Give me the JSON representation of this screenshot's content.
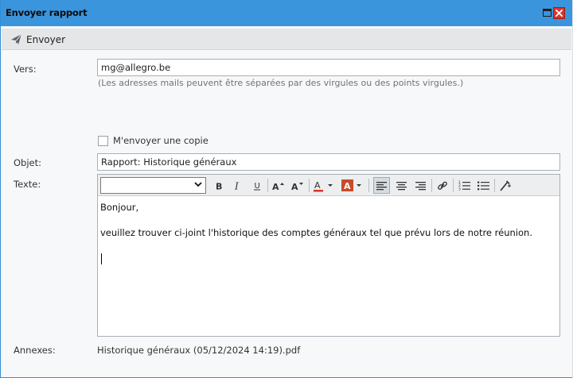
{
  "window": {
    "title": "Envoyer rapport"
  },
  "toolbar": {
    "send_label": "Envoyer"
  },
  "form": {
    "to_label": "Vers:",
    "to_value": "mg@allegro.be",
    "to_hint": "(Les adresses mails peuvent être séparées par des virgules ou des points virgules.)",
    "copy_label": "M'envoyer une copie",
    "copy_checked": false,
    "subject_label": "Objet:",
    "subject_value": "Rapport: Historique généraux",
    "body_label": "Texte:",
    "attachments_label": "Annexes:",
    "attachment_file": "Historique généraux (05/12/2024 14:19).pdf"
  },
  "editor": {
    "font_value": "",
    "tools": [
      "bold",
      "italic",
      "underline",
      "font-size-increase",
      "font-size-decrease",
      "font-color",
      "highlight-color",
      "align-left",
      "align-center",
      "align-right",
      "hyperlink",
      "numbered-list",
      "bullet-list",
      "clear-formatting"
    ],
    "active_tool": "align-left",
    "font_color": "#d9342b",
    "highlight_color": "#c84b2a",
    "lines": [
      "Bonjour,",
      "veuillez trouver ci-joint l'historique des comptes généraux tel que prévu lors de notre réunion."
    ]
  },
  "colors": {
    "titlebar": "#3b95dc",
    "close_button": "#d9342b"
  }
}
